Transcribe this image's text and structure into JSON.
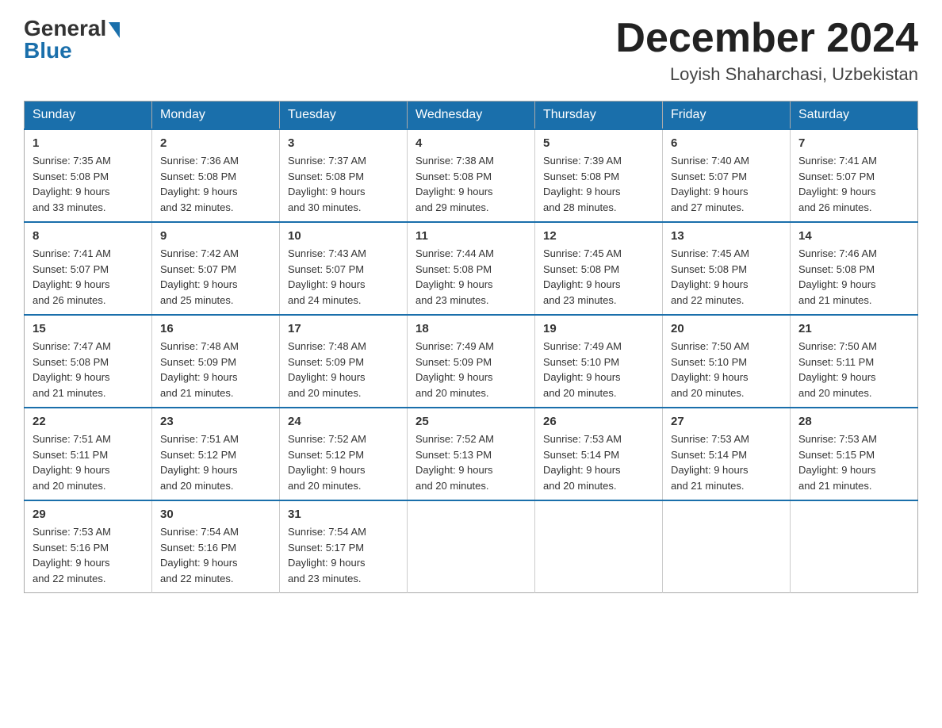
{
  "header": {
    "logo_general": "General",
    "logo_blue": "Blue",
    "month_title": "December 2024",
    "location": "Loyish Shaharchasi, Uzbekistan"
  },
  "weekdays": [
    "Sunday",
    "Monday",
    "Tuesday",
    "Wednesday",
    "Thursday",
    "Friday",
    "Saturday"
  ],
  "weeks": [
    [
      {
        "day": "1",
        "sunrise": "7:35 AM",
        "sunset": "5:08 PM",
        "daylight": "9 hours and 33 minutes."
      },
      {
        "day": "2",
        "sunrise": "7:36 AM",
        "sunset": "5:08 PM",
        "daylight": "9 hours and 32 minutes."
      },
      {
        "day": "3",
        "sunrise": "7:37 AM",
        "sunset": "5:08 PM",
        "daylight": "9 hours and 30 minutes."
      },
      {
        "day": "4",
        "sunrise": "7:38 AM",
        "sunset": "5:08 PM",
        "daylight": "9 hours and 29 minutes."
      },
      {
        "day": "5",
        "sunrise": "7:39 AM",
        "sunset": "5:08 PM",
        "daylight": "9 hours and 28 minutes."
      },
      {
        "day": "6",
        "sunrise": "7:40 AM",
        "sunset": "5:07 PM",
        "daylight": "9 hours and 27 minutes."
      },
      {
        "day": "7",
        "sunrise": "7:41 AM",
        "sunset": "5:07 PM",
        "daylight": "9 hours and 26 minutes."
      }
    ],
    [
      {
        "day": "8",
        "sunrise": "7:41 AM",
        "sunset": "5:07 PM",
        "daylight": "9 hours and 26 minutes."
      },
      {
        "day": "9",
        "sunrise": "7:42 AM",
        "sunset": "5:07 PM",
        "daylight": "9 hours and 25 minutes."
      },
      {
        "day": "10",
        "sunrise": "7:43 AM",
        "sunset": "5:07 PM",
        "daylight": "9 hours and 24 minutes."
      },
      {
        "day": "11",
        "sunrise": "7:44 AM",
        "sunset": "5:08 PM",
        "daylight": "9 hours and 23 minutes."
      },
      {
        "day": "12",
        "sunrise": "7:45 AM",
        "sunset": "5:08 PM",
        "daylight": "9 hours and 23 minutes."
      },
      {
        "day": "13",
        "sunrise": "7:45 AM",
        "sunset": "5:08 PM",
        "daylight": "9 hours and 22 minutes."
      },
      {
        "day": "14",
        "sunrise": "7:46 AM",
        "sunset": "5:08 PM",
        "daylight": "9 hours and 21 minutes."
      }
    ],
    [
      {
        "day": "15",
        "sunrise": "7:47 AM",
        "sunset": "5:08 PM",
        "daylight": "9 hours and 21 minutes."
      },
      {
        "day": "16",
        "sunrise": "7:48 AM",
        "sunset": "5:09 PM",
        "daylight": "9 hours and 21 minutes."
      },
      {
        "day": "17",
        "sunrise": "7:48 AM",
        "sunset": "5:09 PM",
        "daylight": "9 hours and 20 minutes."
      },
      {
        "day": "18",
        "sunrise": "7:49 AM",
        "sunset": "5:09 PM",
        "daylight": "9 hours and 20 minutes."
      },
      {
        "day": "19",
        "sunrise": "7:49 AM",
        "sunset": "5:10 PM",
        "daylight": "9 hours and 20 minutes."
      },
      {
        "day": "20",
        "sunrise": "7:50 AM",
        "sunset": "5:10 PM",
        "daylight": "9 hours and 20 minutes."
      },
      {
        "day": "21",
        "sunrise": "7:50 AM",
        "sunset": "5:11 PM",
        "daylight": "9 hours and 20 minutes."
      }
    ],
    [
      {
        "day": "22",
        "sunrise": "7:51 AM",
        "sunset": "5:11 PM",
        "daylight": "9 hours and 20 minutes."
      },
      {
        "day": "23",
        "sunrise": "7:51 AM",
        "sunset": "5:12 PM",
        "daylight": "9 hours and 20 minutes."
      },
      {
        "day": "24",
        "sunrise": "7:52 AM",
        "sunset": "5:12 PM",
        "daylight": "9 hours and 20 minutes."
      },
      {
        "day": "25",
        "sunrise": "7:52 AM",
        "sunset": "5:13 PM",
        "daylight": "9 hours and 20 minutes."
      },
      {
        "day": "26",
        "sunrise": "7:53 AM",
        "sunset": "5:14 PM",
        "daylight": "9 hours and 20 minutes."
      },
      {
        "day": "27",
        "sunrise": "7:53 AM",
        "sunset": "5:14 PM",
        "daylight": "9 hours and 21 minutes."
      },
      {
        "day": "28",
        "sunrise": "7:53 AM",
        "sunset": "5:15 PM",
        "daylight": "9 hours and 21 minutes."
      }
    ],
    [
      {
        "day": "29",
        "sunrise": "7:53 AM",
        "sunset": "5:16 PM",
        "daylight": "9 hours and 22 minutes."
      },
      {
        "day": "30",
        "sunrise": "7:54 AM",
        "sunset": "5:16 PM",
        "daylight": "9 hours and 22 minutes."
      },
      {
        "day": "31",
        "sunrise": "7:54 AM",
        "sunset": "5:17 PM",
        "daylight": "9 hours and 23 minutes."
      },
      null,
      null,
      null,
      null
    ]
  ],
  "labels": {
    "sunrise": "Sunrise:",
    "sunset": "Sunset:",
    "daylight": "Daylight:"
  }
}
